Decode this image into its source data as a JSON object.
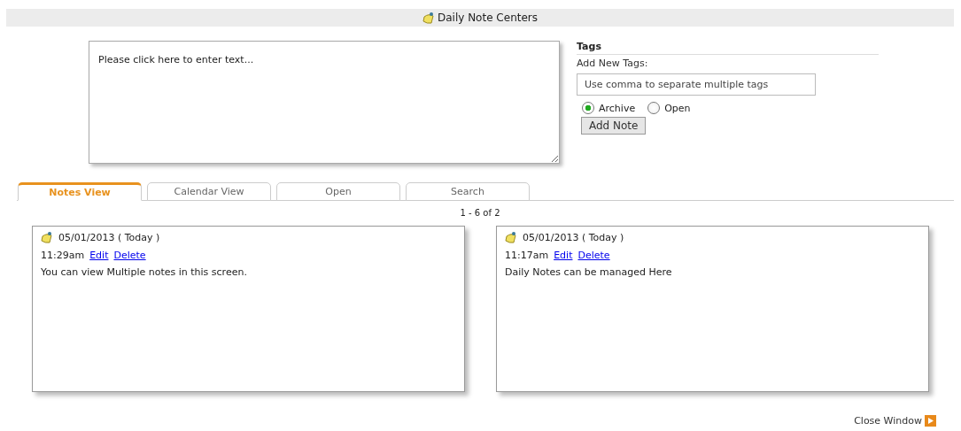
{
  "header": {
    "title": "Daily Note Centers"
  },
  "editor": {
    "placeholder": "Please click here to enter text..."
  },
  "tags": {
    "heading": "Tags",
    "label": "Add New Tags:",
    "placeholder": "Use comma to separate multiple tags",
    "options": [
      {
        "label": "Archive",
        "selected": true
      },
      {
        "label": "Open",
        "selected": false
      }
    ],
    "button": "Add Note"
  },
  "tabs": [
    {
      "label": "Notes View",
      "selected": true
    },
    {
      "label": "Calendar View",
      "selected": false
    },
    {
      "label": "Open",
      "selected": false
    },
    {
      "label": "Search",
      "selected": false
    }
  ],
  "pagination": "1 - 6 of 2",
  "notes": [
    {
      "date": "05/01/2013 ( Today )",
      "time": "11:29am",
      "edit": "Edit",
      "delete": "Delete",
      "text": "You can view Multiple notes in this screen."
    },
    {
      "date": "05/01/2013 ( Today )",
      "time": "11:17am",
      "edit": "Edit",
      "delete": "Delete",
      "text": "Daily Notes can be managed Here"
    }
  ],
  "close": "Close Window"
}
